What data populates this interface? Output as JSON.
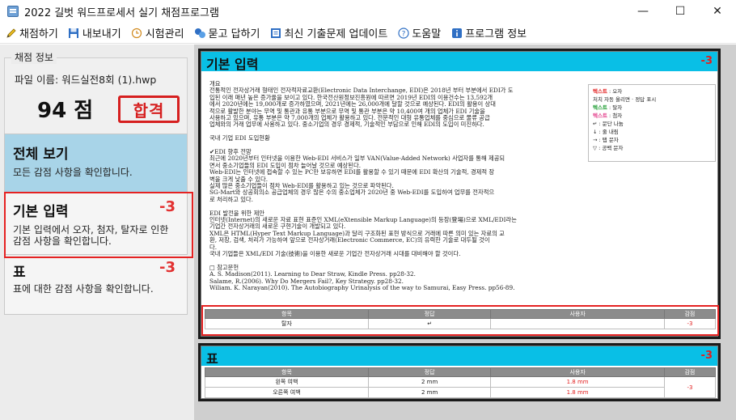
{
  "window": {
    "title": "2022 길벗 워드프로세서 실기 채점프로그램",
    "minimize": "—",
    "maximize": "☐",
    "close": "✕"
  },
  "menu": [
    {
      "label": "채점하기",
      "icon": "pencil-icon"
    },
    {
      "label": "내보내기",
      "icon": "save-icon"
    },
    {
      "label": "시험관리",
      "icon": "clock-icon"
    },
    {
      "label": "묻고 답하기",
      "icon": "qa-icon"
    },
    {
      "label": "최신 기출문제 업데이트",
      "icon": "update-icon"
    },
    {
      "label": "도움말",
      "icon": "help-icon"
    },
    {
      "label": "프로그램 정보",
      "icon": "info-icon"
    }
  ],
  "left": {
    "group_label": "채점 정보",
    "file_name": "파일 이름: 워드실전8회 (1).hwp",
    "score": "94 점",
    "stamp": "합격",
    "categories": [
      {
        "title": "전체 보기",
        "desc": "모든 감점 사항을 확인합니다.",
        "deduct": ""
      },
      {
        "title": "기본 입력",
        "desc": "기본 입력에서 오자, 첨자, 탈자로 인한 감점 사항을 확인합니다.",
        "deduct": "-3"
      },
      {
        "title": "표",
        "desc": "표에 대한 감점 사항을 확인합니다.",
        "deduct": "-3"
      }
    ]
  },
  "sections": [
    {
      "title": "기본 입력",
      "deduct": "-3",
      "doc_lines": [
        "개요",
        "전통적인 전자상거래 형태인 전자적자료교환(Electronic Data Interchange, EDI)은 2018년 부터 부분에서 EDI가 도",
        "입된 이래 매년 높은 증가율을 보이고 있다. 한국전산원정보진흥원에 따르면 2019년 EDI의 이용건수는 13,592개",
        "에서 2020년에는 19,000개로 증가하였으며, 2021년에는 26,000개에 달할 것으로 예상된다. EDI의 활용이 상대",
        "적으로 활발한 분야는 무역 및 통관과 유통 부분으로 무역 및 통관 부분은 약 10,400여 개의 업체가 EDI 기술을",
        "사용하고 있으며, 유통 부분은 약 7,000개의 업체가 활용하고 있다. 전문적인 대형 유통업체를 중심으로 물류 공급",
        "업체와의 거래 업무에 사용하고 있다. 중소기업의 경우 경제적, 기술적인 부담으로 인해 EDI의 도입이 미진하다.",
        "",
        "국내 기업 EDI 도입현황",
        "",
        "✔EDI 향후 전망",
        "최근에 2020년부터 인터넷을 이용한 Web-EDI 서비스가 일부 VAN(Value-Added Network) 사업자를 통해 제공되",
        "면서 중소기업들의 EDI 도입이 점차 늘어날 것으로 예상된다.",
        "Web-EDI는 인터넷에 접속할 수 있는 PC만 보유하면 EDI를 활용할 수 있기 때문에 EDI 확산의 기술적, 경제적 장",
        "벽을 크게 낮출 수 있다.",
        "실제 많은 중소기업들이 점차 Web-EDI를 활용하고 있는 것으로 파악된다.",
        "SG-Mart와 상공회의소 공급업체의 경우 많은 수의 중소업체가 2020년 중 Web-EDI를 도입하여 업무를 전자적으",
        "로 처리하고 있다.",
        "",
        "EDI 발전을 위한 제안",
        "인터넷(Internet)의 새로운 자료 표현 표준인 XML(eXtensible Markup Language)의 등장(登場)으로 XML/EDI라는",
        "기업간 전자상거래의 새로운 구현기술이 개발되고 있다.",
        "XML은 HTML(Hyper Text Markup Language)과 달리 구조화된 표현 방식으로 거래에 따른 의미 있는 자료의 교",
        "환, 저장, 검색, 처리가 가능하여 앞으로 전자상거래(Electronic Commerce, EC)의 유력한 기술로 대두될 것이",
        "다.",
        "국내 기업들은 XML/EDI 기술(技術)을 이용한 새로운 기업간 전자상거래 시대를 대비해야 할 것이다.",
        "",
        "□ 참고문헌",
        "A. S. Madison(2011). Learning to Dear Straw, Kindle Press. pp28-32.",
        "Salame, R.(2006). Why Do Mergers Fail?, Key Strategy. pp28-32.",
        "Wiliam. K. Narayan(2010). The Autobiography Urinalysis of the way to Samurai, Easy Press. pp56-89."
      ],
      "legend": [
        {
          "label": "텍스트",
          "suffix": " : 오자",
          "style": "red"
        },
        {
          "label": "",
          "suffix": "       처치 자동 올리면 · 정답 표시",
          "style": ""
        },
        {
          "label": "텍스트",
          "suffix": " : 탈자",
          "style": "green"
        },
        {
          "label": "텍스트",
          "suffix": " : 첨자",
          "style": "pink"
        },
        {
          "label": "↵",
          "suffix": " : 문단 나눔",
          "style": ""
        },
        {
          "label": "↓",
          "suffix": " : 줄 내림",
          "style": ""
        },
        {
          "label": "→",
          "suffix": " : 탭 문자",
          "style": ""
        },
        {
          "label": "▽",
          "suffix": " : 공백 문자",
          "style": ""
        }
      ],
      "table": {
        "headers": [
          "항목",
          "정답",
          "사용자",
          "감점"
        ],
        "rows": [
          {
            "item": "탈자",
            "answer": "↵",
            "user": "",
            "deduct": "-3"
          }
        ]
      }
    },
    {
      "title": "표",
      "deduct": "-3",
      "table": {
        "headers": [
          "항목",
          "정답",
          "사용자",
          "감점"
        ],
        "rows": [
          {
            "item": "왼쪽 여백",
            "answer": "2 mm",
            "user": "1.8 mm",
            "deduct": "-3"
          },
          {
            "item": "오른쪽 여백",
            "answer": "2 mm",
            "user": "1.8 mm",
            "deduct": ""
          }
        ]
      }
    }
  ],
  "colors": {
    "accent": "#09bfe6",
    "overall_card": "#a8d4e8",
    "deduct_red": "#e23131",
    "highlight_border": "#e52222"
  }
}
